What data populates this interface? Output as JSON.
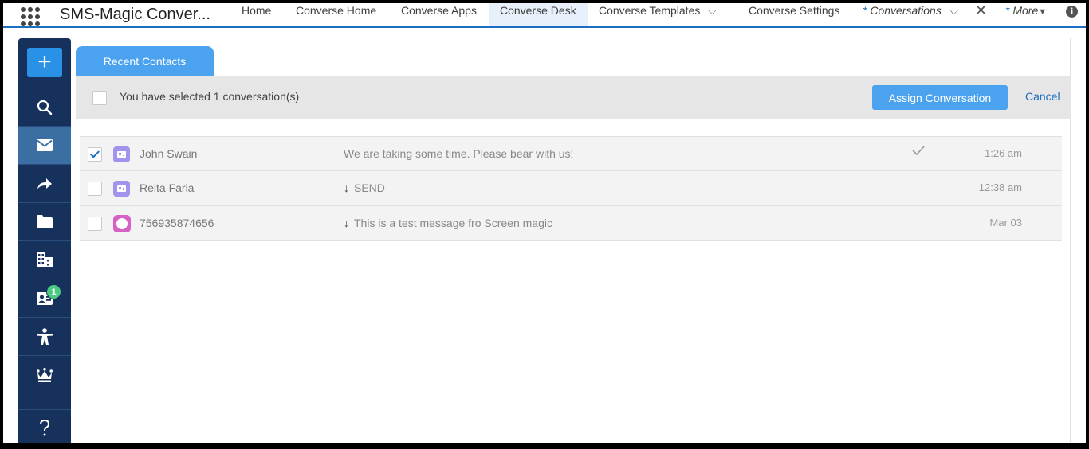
{
  "app": {
    "name": "SMS-Magic Conver..."
  },
  "nav": {
    "tabs": [
      {
        "label": "Home"
      },
      {
        "label": "Converse Home"
      },
      {
        "label": "Converse Apps"
      },
      {
        "label": "Converse Desk"
      },
      {
        "label": "Converse Templates"
      },
      {
        "label": "Converse Settings"
      },
      {
        "label": "Conversations",
        "star": "*"
      },
      {
        "label": "More",
        "star": "*"
      }
    ]
  },
  "sidebar": {
    "add_label": "+",
    "badge_count": "1",
    "icons": [
      "search-icon",
      "envelope-icon",
      "forward-arrow-icon",
      "folder-icon",
      "building-icon",
      "contact-card-icon",
      "person-star-icon",
      "crown-icon",
      "help-icon"
    ]
  },
  "main": {
    "tab_label": "Recent Contacts",
    "selection_text": "You have selected 1 conversation(s)",
    "assign_label": "Assign Conversation",
    "cancel_label": "Cancel"
  },
  "conversations": [
    {
      "name": "John Swain",
      "message": "We are taking some time. Please bear with us!",
      "time": "1:26 am",
      "checked": true,
      "direction": "",
      "icon": "contact-icon",
      "status": "read"
    },
    {
      "name": "Reita Faria",
      "message": "SEND",
      "time": "12:38 am",
      "checked": false,
      "direction": "↓",
      "icon": "contact-icon",
      "status": ""
    },
    {
      "name": "756935874656",
      "message": "This is a test message fro Screen magic",
      "time": "Mar 03",
      "checked": false,
      "direction": "↓",
      "icon": "person-icon",
      "status": ""
    }
  ],
  "colors": {
    "accent": "#4ba3ef",
    "nav_border": "#1b6ec2",
    "sidebar": "#16325c",
    "badge": "#4bca81",
    "contact_icon": "#a094ed",
    "person_icon": "#d662c4"
  }
}
